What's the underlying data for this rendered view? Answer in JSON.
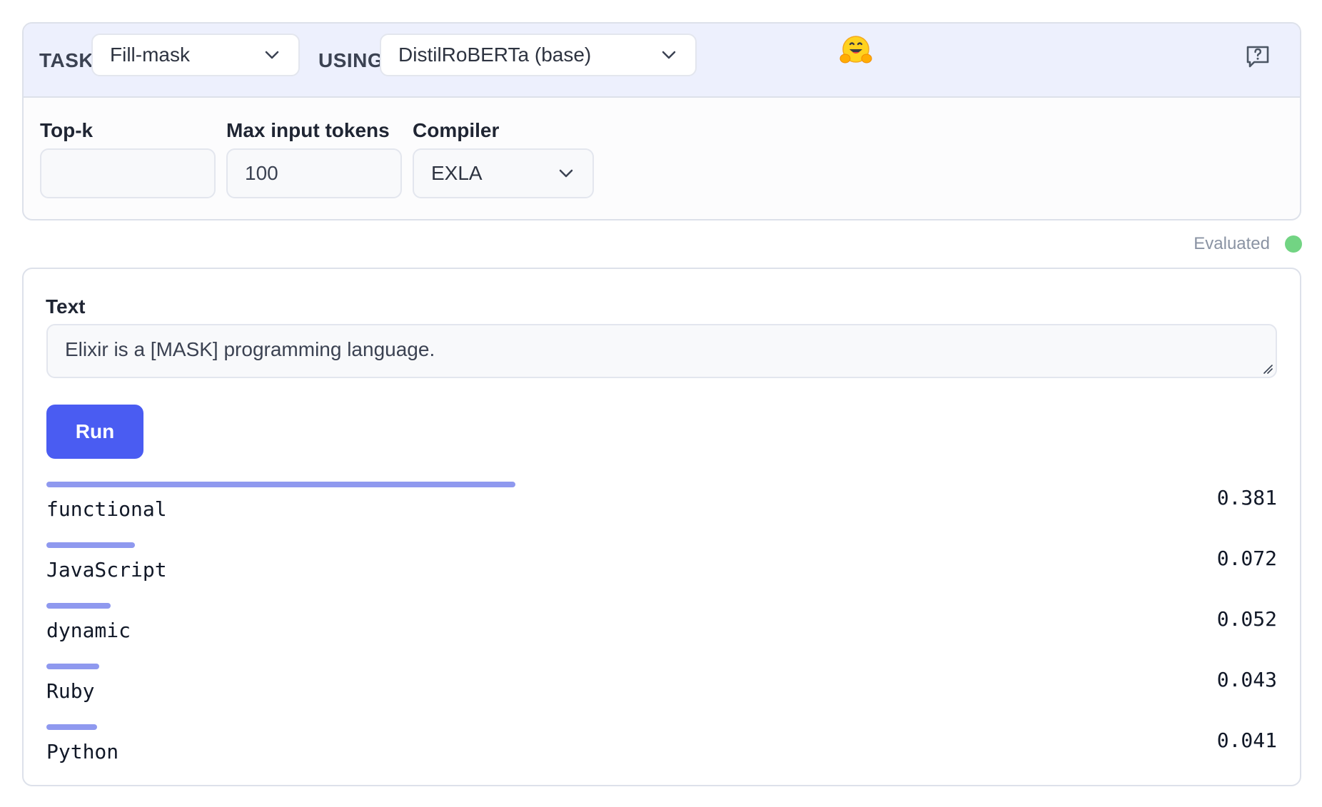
{
  "header": {
    "task_label": "TASK",
    "task_value": "Fill-mask",
    "using_label": "USING",
    "model_value": "DistilRoBERTa (base)",
    "source_icon": "hugging-face-icon",
    "help_icon": "help-question-icon"
  },
  "fields": {
    "topk_label": "Top-k",
    "topk_value": "",
    "max_tokens_label": "Max input tokens",
    "max_tokens_value": "100",
    "compiler_label": "Compiler",
    "compiler_value": "EXLA"
  },
  "status": {
    "text": "Evaluated",
    "color": "#72d483"
  },
  "input": {
    "label": "Text",
    "value": "Elixir is a [MASK] programming language."
  },
  "run_label": "Run",
  "results": [
    {
      "label": "functional",
      "score": "0.381",
      "fraction": 0.381
    },
    {
      "label": "JavaScript",
      "score": "0.072",
      "fraction": 0.072
    },
    {
      "label": "dynamic",
      "score": "0.052",
      "fraction": 0.052
    },
    {
      "label": "Ruby",
      "score": "0.043",
      "fraction": 0.043
    },
    {
      "label": "Python",
      "score": "0.041",
      "fraction": 0.041
    }
  ],
  "colors": {
    "accent": "#4a5cf2",
    "bar": "#8f99ef",
    "header_bg": "#edf0fd"
  }
}
